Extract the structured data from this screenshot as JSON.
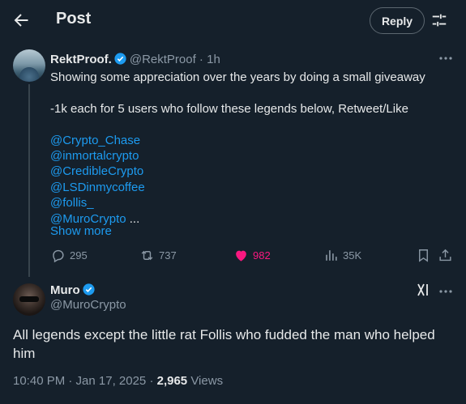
{
  "header": {
    "title": "Post",
    "reply_label": "Reply"
  },
  "tweet": {
    "display_name": "RektProof.",
    "handle": "@RektProof",
    "time": "1h",
    "line1": "Showing some appreciation over the years by doing a small giveaway",
    "line2": "-1k each for 5 users who follow these legends below, Retweet/Like",
    "mentions": [
      "@Crypto_Chase",
      "@inmortalcrypto",
      "@CredibleCrypto",
      "@LSDinmycoffee",
      "@follis_",
      "@MuroCrypto"
    ],
    "ellipsis": " ...",
    "show_more": "Show more",
    "replies": "295",
    "retweets": "737",
    "likes": "982",
    "views": "35K"
  },
  "reply": {
    "display_name": "Muro",
    "handle": "@MuroCrypto",
    "text": "All legends except the little rat Follis who fudded the man who helped him",
    "date": "10:40 PM · Jan 17, 2025 · ",
    "views_count": "2,965",
    "views_label": " Views"
  },
  "colors": {
    "background": "#15202b",
    "accent": "#1d9bf0",
    "like": "#f91880",
    "muted": "#8b98a5"
  },
  "icons": [
    "back-arrow-icon",
    "tune-icon",
    "verified-icon",
    "more-icon",
    "reply-icon",
    "retweet-icon",
    "heart-icon",
    "views-icon",
    "bookmark-icon",
    "share-icon",
    "grok-icon"
  ]
}
